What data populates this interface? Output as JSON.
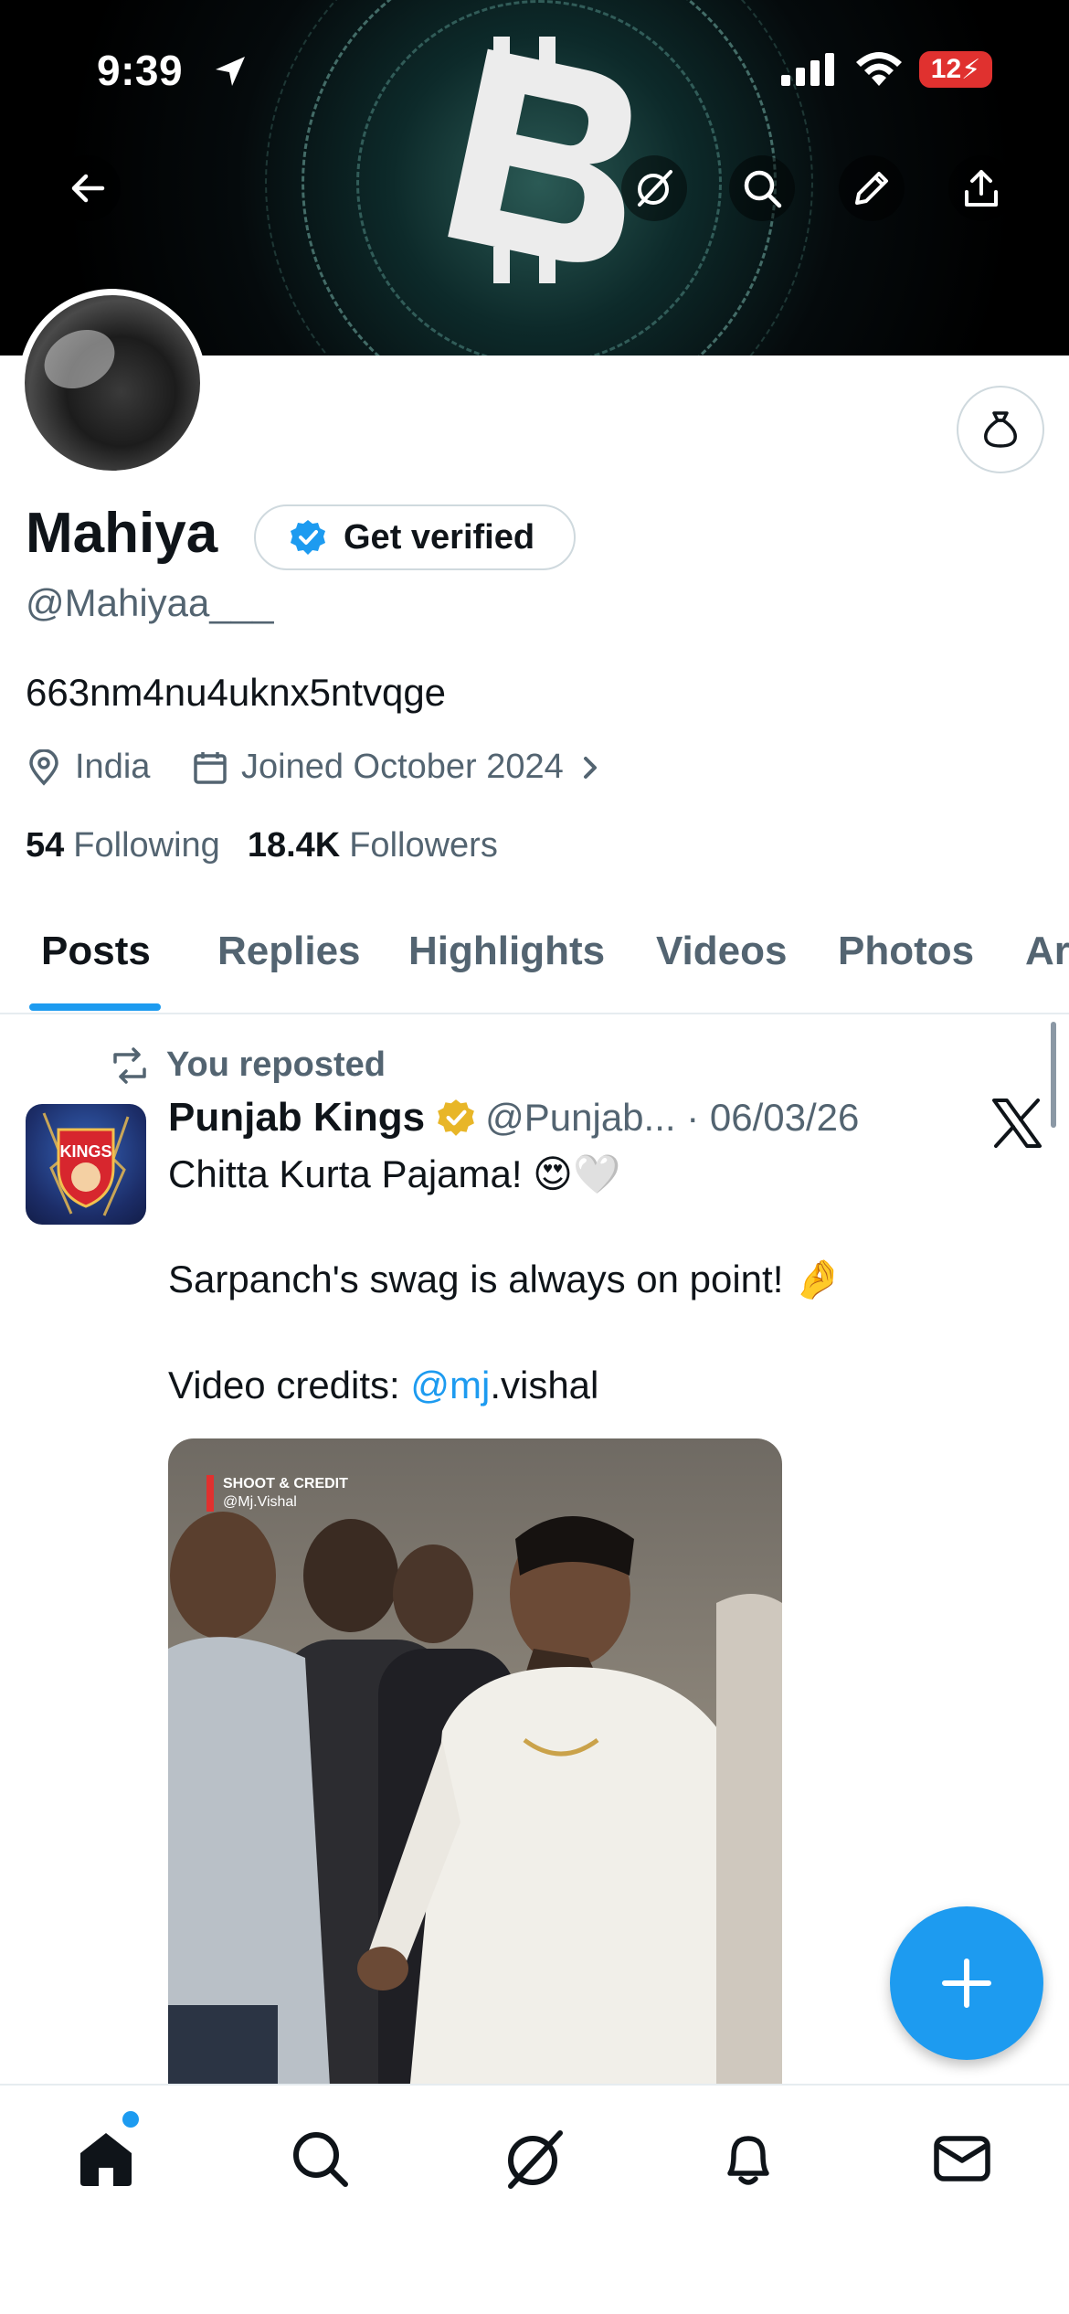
{
  "status_bar": {
    "time": "9:39",
    "battery": "12"
  },
  "profile": {
    "name": "Mahiya",
    "verify_label": "Get verified",
    "handle": "@Mahiyaa___",
    "bio": "663nm4nu4uknx5ntvqge",
    "location": "India",
    "joined": "Joined October 2024",
    "following_count": "54",
    "following_label": "Following",
    "followers_count": "18.4K",
    "followers_label": "Followers"
  },
  "tabs": [
    {
      "label": "Posts"
    },
    {
      "label": "Replies"
    },
    {
      "label": "Highlights"
    },
    {
      "label": "Videos"
    },
    {
      "label": "Photos"
    },
    {
      "label": "Ar"
    }
  ],
  "post": {
    "repost_label": "You reposted",
    "author": "Punjab Kings",
    "handle_date": "@Punjab... · 06/03/26",
    "line1": "Chitta Kurta Pajama! 😍🤍",
    "line2": "Sarpanch's swag is always on point! 🤌",
    "line3_prefix": "Video credits: ",
    "line3_mention": "@mj",
    "line3_suffix": ".vishal",
    "media_credit_1": "SHOOT & CREDIT",
    "media_credit_2": "@Mj.Vishal",
    "avatar_text": "KINGS"
  },
  "colors": {
    "accent": "#1d9bf0",
    "secondary_text": "#536471",
    "verified_gold": "#e8b628"
  }
}
